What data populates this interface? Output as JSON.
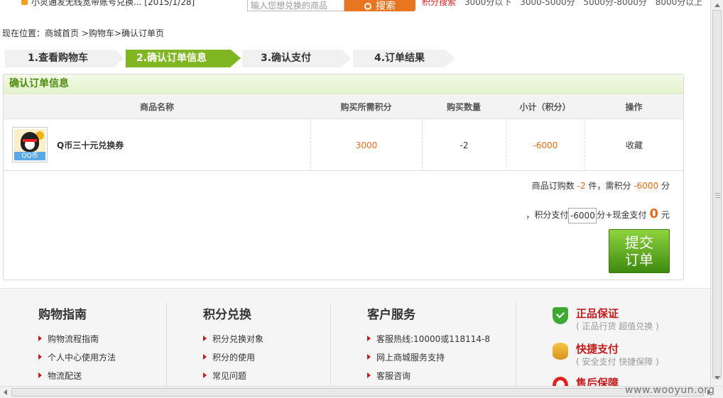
{
  "topbar": {
    "notice": "小灵通发无线宽带账号兑换... [2015/1/28]",
    "search_placeholder": "输入您想兑换的商品",
    "search_button": "搜索",
    "hot_label": "积分搜索",
    "ranges": [
      "3000分以下",
      "3000-5000分",
      "5000分-8000分",
      "8000分以上"
    ]
  },
  "breadcrumb": {
    "label": "现在位置：",
    "path": "商城首页 >购物车>确认订单页"
  },
  "steps": [
    {
      "label": "1.查看购物车",
      "active": false
    },
    {
      "label": "2.确认订单信息",
      "active": true
    },
    {
      "label": "3.确认支付",
      "active": false
    },
    {
      "label": "4.订单结果",
      "active": false
    }
  ],
  "order": {
    "title": "确认订单信息",
    "columns": [
      "商品名称",
      "购买所需积分",
      "购买数量",
      "小计（积分）",
      "操作"
    ],
    "item": {
      "thumb_tag": "QQ币",
      "name": "Q币三十元兑换券",
      "points": "3000",
      "quantity": "-2",
      "subtotal": "-6000",
      "action": "收藏"
    },
    "summary": {
      "prefix": "商品订购数",
      "count": "-2",
      "mid": "件，需积分",
      "points": "-6000",
      "suffix": "分"
    },
    "pay": {
      "prefix": "，积分支付",
      "points_value": "-6000",
      "mid": "分+现金支付",
      "cash": "0",
      "suffix": "元"
    },
    "submit_label": "提交订单"
  },
  "footer": {
    "columns": [
      {
        "title": "购物指南",
        "items": [
          "购物流程指南",
          "个人中心使用方法",
          "物流配送"
        ]
      },
      {
        "title": "积分兑换",
        "items": [
          "积分兑换对象",
          "积分的使用",
          "常见问题"
        ]
      },
      {
        "title": "客户服务",
        "items": [
          "客服热线:10000或118114-8",
          "网上商城服务支持",
          "客服咨询"
        ]
      }
    ],
    "guarantees": [
      {
        "title": "正品保证",
        "sub": "( 正品行货  超值兑换 )",
        "icon": "shield-icon"
      },
      {
        "title": "快捷支付",
        "sub": "( 安全支付  快捷保障 )",
        "icon": "coins-icon"
      },
      {
        "title": "售后保障",
        "sub": "",
        "icon": "lifebuoy-icon"
      }
    ]
  },
  "watermark": "www.wooyun.org",
  "colors": {
    "accent_green": "#80b621",
    "orange": "#e56b16",
    "brand_red": "#c41a1a"
  }
}
